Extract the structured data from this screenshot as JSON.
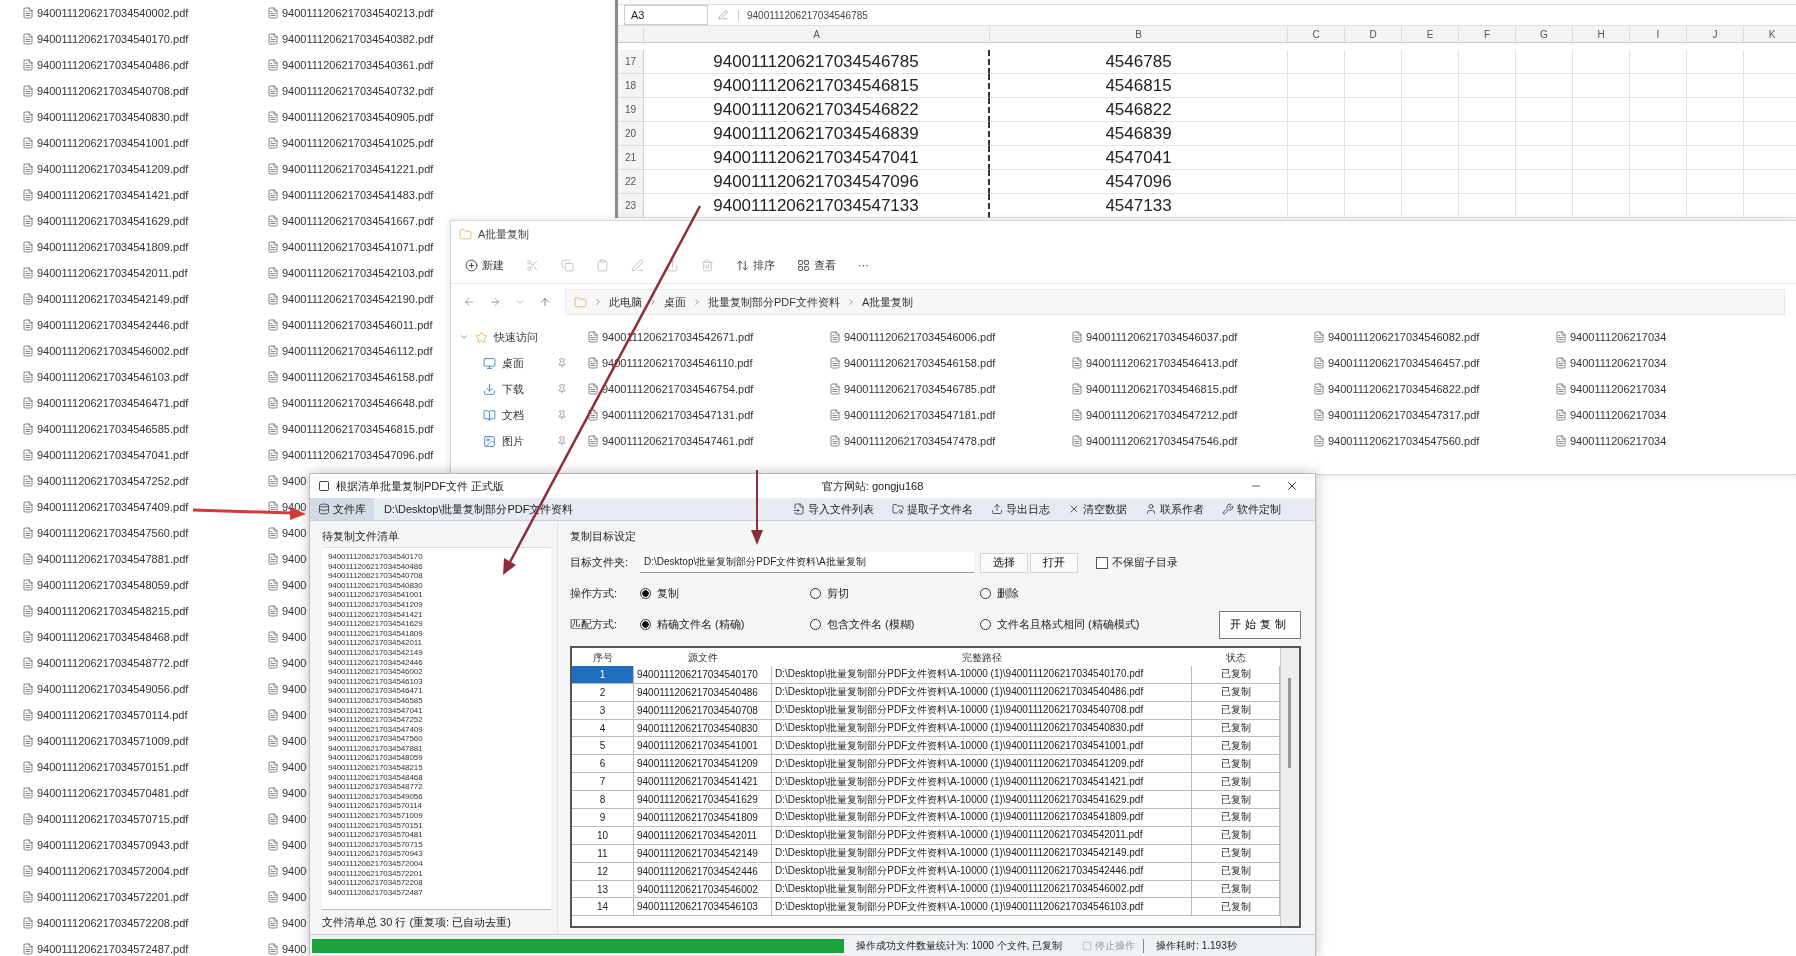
{
  "desktop_files": {
    "column_1": [
      "9400111206217034540002.pdf",
      "9400111206217034540170.pdf",
      "9400111206217034540486.pdf",
      "9400111206217034540708.pdf",
      "9400111206217034540830.pdf",
      "9400111206217034541001.pdf",
      "9400111206217034541209.pdf",
      "9400111206217034541421.pdf",
      "9400111206217034541629.pdf",
      "9400111206217034541809.pdf",
      "9400111206217034542011.pdf",
      "9400111206217034542149.pdf",
      "9400111206217034542446.pdf",
      "9400111206217034546002.pdf",
      "9400111206217034546103.pdf",
      "9400111206217034546471.pdf",
      "9400111206217034546585.pdf",
      "9400111206217034547041.pdf",
      "9400111206217034547252.pdf",
      "9400111206217034547409.pdf",
      "9400111206217034547560.pdf",
      "9400111206217034547881.pdf",
      "9400111206217034548059.pdf",
      "9400111206217034548215.pdf",
      "9400111206217034548468.pdf",
      "9400111206217034548772.pdf",
      "9400111206217034549056.pdf",
      "9400111206217034570114.pdf",
      "9400111206217034571009.pdf",
      "9400111206217034570151.pdf",
      "9400111206217034570481.pdf",
      "9400111206217034570715.pdf",
      "9400111206217034570943.pdf",
      "9400111206217034572004.pdf",
      "9400111206217034572201.pdf",
      "9400111206217034572208.pdf",
      "9400111206217034572487.pdf"
    ],
    "column_2": [
      "9400111206217034540213.pdf",
      "9400111206217034540382.pdf",
      "9400111206217034540361.pdf",
      "9400111206217034540732.pdf",
      "9400111206217034540905.pdf",
      "9400111206217034541025.pdf",
      "9400111206217034541221.pdf",
      "9400111206217034541483.pdf",
      "9400111206217034541667.pdf",
      "9400111206217034541071.pdf",
      "9400111206217034542103.pdf",
      "9400111206217034542190.pdf",
      "9400111206217034546011.pdf",
      "9400111206217034546112.pdf",
      "9400111206217034546158.pdf",
      "9400111206217034546648.pdf",
      "9400111206217034546815.pdf",
      "9400111206217034547096.pdf",
      "9400",
      "9400",
      "9400",
      "9400",
      "9400",
      "9400",
      "9400",
      "9400",
      "9400",
      "9400",
      "9400",
      "9400",
      "9400",
      "9400",
      "9400",
      "9400",
      "9400",
      "9400",
      "9400"
    ]
  },
  "spreadsheet": {
    "name_box": "A3",
    "formula": "9400111206217034546785",
    "columns": [
      "A",
      "B",
      "C",
      "D",
      "E",
      "F",
      "G",
      "H",
      "I",
      "J",
      "K"
    ],
    "rows": [
      {
        "number": "17",
        "cells": [
          "9400111206217034546785",
          "4546785"
        ]
      },
      {
        "number": "18",
        "cells": [
          "9400111206217034546815",
          "4546815"
        ]
      },
      {
        "number": "19",
        "cells": [
          "9400111206217034546822",
          "4546822"
        ]
      },
      {
        "number": "20",
        "cells": [
          "9400111206217034546839",
          "4546839"
        ]
      },
      {
        "number": "21",
        "cells": [
          "9400111206217034547041",
          "4547041"
        ]
      },
      {
        "number": "22",
        "cells": [
          "9400111206217034547096",
          "4547096"
        ]
      },
      {
        "number": "23",
        "cells": [
          "9400111206217034547133",
          "4547133"
        ]
      }
    ]
  },
  "explorer": {
    "title": "A批量复制",
    "new": "新建",
    "sort": "排序",
    "view": "查看",
    "more": "···",
    "breadcrumb": [
      "此电脑",
      "桌面",
      "批量复制部分PDF文件资料",
      "A批量复制"
    ],
    "sidebar": [
      {
        "label": "快速访问",
        "kind": "quick"
      },
      {
        "label": "桌面",
        "kind": "desktop"
      },
      {
        "label": "下载",
        "kind": "download"
      },
      {
        "label": "文档",
        "kind": "document"
      },
      {
        "label": "图片",
        "kind": "picture"
      }
    ],
    "files": [
      "9400111206217034542671.pdf",
      "9400111206217034546006.pdf",
      "9400111206217034546037.pdf",
      "9400111206217034546082.pdf",
      "9400111206217034",
      "9400111206217034546110.pdf",
      "9400111206217034546158.pdf",
      "9400111206217034546413.pdf",
      "9400111206217034546457.pdf",
      "9400111206217034",
      "9400111206217034546754.pdf",
      "9400111206217034546785.pdf",
      "9400111206217034546815.pdf",
      "9400111206217034546822.pdf",
      "9400111206217034",
      "9400111206217034547131.pdf",
      "9400111206217034547181.pdf",
      "9400111206217034547212.pdf",
      "9400111206217034547317.pdf",
      "9400111206217034",
      "9400111206217034547461.pdf",
      "9400111206217034547478.pdf",
      "9400111206217034547546.pdf",
      "9400111206217034547560.pdf",
      "9400111206217034"
    ]
  },
  "dialog": {
    "title": "根据清单批量复制PDF文件 正式版",
    "subtitle": "官方网站: gongju168",
    "library_button": "文件库",
    "library_path": "D:\\Desktop\\批量复制部分PDF文件资料",
    "tools": [
      {
        "label": "导入文件列表",
        "kind": "import"
      },
      {
        "label": "提取子文件名",
        "kind": "extract"
      },
      {
        "label": "导出日志",
        "kind": "export"
      },
      {
        "label": "清空数据",
        "kind": "clear"
      },
      {
        "label": "联系作者",
        "kind": "contact"
      },
      {
        "label": "软件定制",
        "kind": "custom"
      }
    ],
    "list": {
      "title": "待复制文件清单",
      "footer": "文件清单总 30 行 (重复项: 已自动去重)",
      "items": [
        "9400111206217034540170",
        "9400111206217034540486",
        "9400111206217034540708",
        "9400111206217034540830",
        "9400111206217034541001",
        "9400111206217034541209",
        "9400111206217034541421",
        "9400111206217034541629",
        "9400111206217034541809",
        "9400111206217034542011",
        "9400111206217034542149",
        "9400111206217034542446",
        "9400111206217034546002",
        "9400111206217034546103",
        "9400111206217034546471",
        "9400111206217034546585",
        "9400111206217034547041",
        "9400111206217034547252",
        "9400111206217034547409",
        "9400111206217034547560",
        "9400111206217034547881",
        "9400111206217034548059",
        "9400111206217034548215",
        "9400111206217034548468",
        "9400111206217034548772",
        "9400111206217034549056",
        "9400111206217034570114",
        "9400111206217034571009",
        "9400111206217034570151",
        "9400111206217034570481",
        "9400111206217034570715",
        "9400111206217034570943",
        "9400111206217034572004",
        "9400111206217034572201",
        "9400111206217034572208",
        "9400111206217034572487"
      ]
    },
    "target": {
      "title": "复制目标设定",
      "folder_label": "目标文件夹:",
      "folder": "D:\\Desktop\\批量复制部分PDF文件资料\\A批量复制",
      "choose": "选择",
      "open": "打开",
      "keep_structure": {
        "label": "不保留子目录",
        "checked": false
      }
    },
    "operation": {
      "label": "操作方式:",
      "options": [
        {
          "label": "复制",
          "selected": true
        },
        {
          "label": "剪切",
          "selected": false
        },
        {
          "label": "删除",
          "selected": false
        }
      ]
    },
    "match": {
      "label": "匹配方式:",
      "options": [
        {
          "label": "精确文件名 (精确)",
          "selected": true
        },
        {
          "label": "包含文件名 (模糊)",
          "selected": false
        },
        {
          "label": "文件名且格式相同 (精确模式)",
          "selected": false
        }
      ]
    },
    "start": "开始复制",
    "table": {
      "columns": [
        "序号",
        "源文件",
        "完整路径",
        "状态"
      ],
      "rows": [
        {
          "index": "1",
          "source": "9400111206217034540170",
          "path": "D:\\Desktop\\批量复制部分PDF文件资料\\A-10000 (1)\\9400111206217034540170.pdf",
          "status": "已复制",
          "selected": true
        },
        {
          "index": "2",
          "source": "9400111206217034540486",
          "path": "D:\\Desktop\\批量复制部分PDF文件资料\\A-10000 (1)\\9400111206217034540486.pdf",
          "status": "已复制",
          "selected": false
        },
        {
          "index": "3",
          "source": "9400111206217034540708",
          "path": "D:\\Desktop\\批量复制部分PDF文件资料\\A-10000 (1)\\9400111206217034540708.pdf",
          "status": "已复制",
          "selected": false
        },
        {
          "index": "4",
          "source": "9400111206217034540830",
          "path": "D:\\Desktop\\批量复制部分PDF文件资料\\A-10000 (1)\\9400111206217034540830.pdf",
          "status": "已复制",
          "selected": false
        },
        {
          "index": "5",
          "source": "9400111206217034541001",
          "path": "D:\\Desktop\\批量复制部分PDF文件资料\\A-10000 (1)\\9400111206217034541001.pdf",
          "status": "已复制",
          "selected": false
        },
        {
          "index": "6",
          "source": "9400111206217034541209",
          "path": "D:\\Desktop\\批量复制部分PDF文件资料\\A-10000 (1)\\9400111206217034541209.pdf",
          "status": "已复制",
          "selected": false
        },
        {
          "index": "7",
          "source": "9400111206217034541421",
          "path": "D:\\Desktop\\批量复制部分PDF文件资料\\A-10000 (1)\\9400111206217034541421.pdf",
          "status": "已复制",
          "selected": false
        },
        {
          "index": "8",
          "source": "9400111206217034541629",
          "path": "D:\\Desktop\\批量复制部分PDF文件资料\\A-10000 (1)\\9400111206217034541629.pdf",
          "status": "已复制",
          "selected": false
        },
        {
          "index": "9",
          "source": "9400111206217034541809",
          "path": "D:\\Desktop\\批量复制部分PDF文件资料\\A-10000 (1)\\9400111206217034541809.pdf",
          "status": "已复制",
          "selected": false
        },
        {
          "index": "10",
          "source": "9400111206217034542011",
          "path": "D:\\Desktop\\批量复制部分PDF文件资料\\A-10000 (1)\\9400111206217034542011.pdf",
          "status": "已复制",
          "selected": false
        },
        {
          "index": "11",
          "source": "9400111206217034542149",
          "path": "D:\\Desktop\\批量复制部分PDF文件资料\\A-10000 (1)\\9400111206217034542149.pdf",
          "status": "已复制",
          "selected": false
        },
        {
          "index": "12",
          "source": "9400111206217034542446",
          "path": "D:\\Desktop\\批量复制部分PDF文件资料\\A-10000 (1)\\9400111206217034542446.pdf",
          "status": "已复制",
          "selected": false
        },
        {
          "index": "13",
          "source": "9400111206217034546002",
          "path": "D:\\Desktop\\批量复制部分PDF文件资料\\A-10000 (1)\\9400111206217034546002.pdf",
          "status": "已复制",
          "selected": false
        },
        {
          "index": "14",
          "source": "9400111206217034546103",
          "path": "D:\\Desktop\\批量复制部分PDF文件资料\\A-10000 (1)\\9400111206217034546103.pdf",
          "status": "已复制",
          "selected": false
        }
      ]
    },
    "status": {
      "progress": {
        "level": 1
      },
      "message": "操作成功文件数量统计为: 1000 个文件, 已复制",
      "stop": "停止操作",
      "elapsed": "操作耗时: 1.193秒"
    }
  }
}
